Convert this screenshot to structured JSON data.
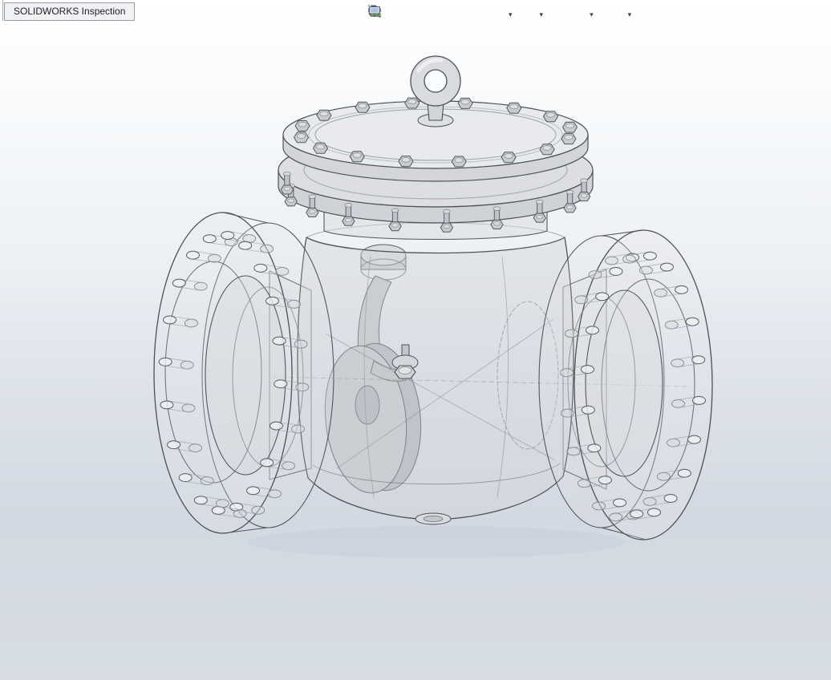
{
  "app": {
    "tab_label": "SOLIDWORKS Inspection"
  },
  "toolbar": {
    "items": [
      {
        "name": "zoom-to-fit-icon",
        "dropdown": false
      },
      {
        "name": "zoom-to-area-icon",
        "dropdown": false
      },
      {
        "name": "zoom-in-out-icon",
        "dropdown": false
      },
      {
        "name": "section-view-icon",
        "dropdown": false
      },
      {
        "name": "measure-icon",
        "dropdown": false
      },
      {
        "name": "annotation-view-icon",
        "dropdown": false
      },
      {
        "name": "view-orientation-icon",
        "dropdown": true
      },
      {
        "name": "hide-show-items-icon",
        "dropdown": true
      },
      {
        "name": "edit-appearance-icon",
        "dropdown": false
      },
      {
        "name": "apply-scene-icon",
        "dropdown": true
      },
      {
        "name": "view-settings-icon",
        "dropdown": true
      }
    ]
  },
  "viewport": {
    "background_top": "#ffffff",
    "background_bottom": "#d3d9e2",
    "edge_color": "#4f5257",
    "model": {
      "subject": "swing-check-valve-3d-model",
      "display_style": "transparent-shaded-with-edges",
      "features": [
        "lifting-eye-ring",
        "bolted-top-cover",
        "bolted-bonnet-flange",
        "left-pipe-flange-with-bolt-holes",
        "right-pipe-flange-with-bolt-holes",
        "internal-swing-disc-and-arm"
      ]
    }
  }
}
